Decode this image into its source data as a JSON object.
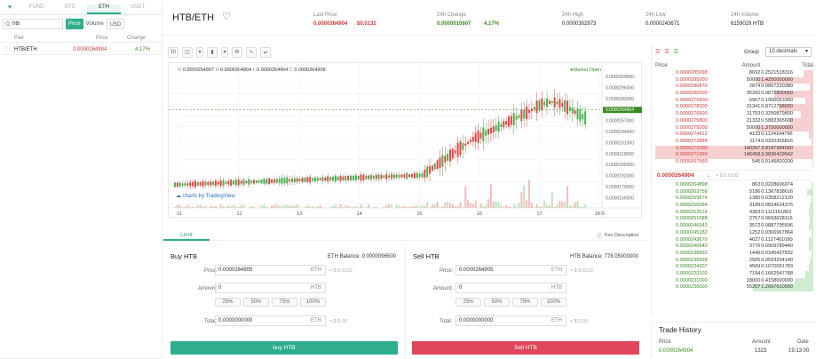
{
  "left": {
    "tabs": [
      "FUND",
      "BTC",
      "ETH",
      "USDT"
    ],
    "active_tab": "ETH",
    "search_value": "htb",
    "toggles": [
      "Price",
      "Volume",
      "USD"
    ],
    "headers": [
      "Pair",
      "Price",
      "Change"
    ],
    "rows": [
      {
        "pair": "HTB/ETH",
        "price": "0.0000264904",
        "change": "4.17%"
      }
    ]
  },
  "header": {
    "pair": "HTB/ETH",
    "last_price_label": "Last Price",
    "last_price": "0.0000264904",
    "last_price_usd": "$0.0132",
    "change_label": "24h Change",
    "change_value": "0.0000010607",
    "change_pct": "4.17%",
    "high_label": "24h High",
    "high_value": "0.0000302973",
    "low_label": "24h Low",
    "low_value": "0.0000243671",
    "volume_label": "24h Volume",
    "volume_value": "6159029 HTB"
  },
  "chart": {
    "interval": "1h",
    "ohlc": {
      "o": "0.0000264907",
      "h": "0.0000264904",
      "l": "0.0000264904",
      "c": "0.0000264908"
    },
    "market_status": "Market Open",
    "credit": "charts by TradingView",
    "price_labels": [
      "0.0000309000",
      "0.0000296000",
      "0.0000283000",
      "0.0000264904",
      "0.0000257000",
      "0.0000244000",
      "0.0000231000",
      "0.0000218000",
      "0.0000205000",
      "0.0000192000",
      "0.0000179000",
      "0.0000166000"
    ],
    "current_price": "0.0000264904",
    "x_labels": [
      "11",
      "12",
      "13",
      "14",
      "15",
      "16",
      "17",
      "18:0"
    ]
  },
  "trade": {
    "tab": "Limit",
    "fee_link": "Fee Description",
    "buy": {
      "title": "Buy HTB",
      "balance": "ETH Balance: 0.0000096500",
      "price_label": "Price:",
      "price": "0.0000264905",
      "price_unit": "ETH",
      "price_usd": "≈ $ 0.0132",
      "amount_label": "Amount:",
      "amount": "0",
      "amount_unit": "HTB",
      "pcts": [
        "25%",
        "50%",
        "75%",
        "100%"
      ],
      "total_label": "Total:",
      "total": "0.0000000000",
      "total_unit": "ETH",
      "total_usd": "≈ $ 0.00",
      "button": "buy HTB"
    },
    "sell": {
      "title": "Sell HTB",
      "balance": "HTB Balance: 778.05000000",
      "price_label": "Price:",
      "price": "0.0000264905",
      "price_unit": "ETH",
      "price_usd": "≈ $ 0.0132",
      "amount_label": "Amount:",
      "amount": "0",
      "amount_unit": "HTB",
      "pcts": [
        "25%",
        "50%",
        "75%",
        "100%"
      ],
      "total_label": "Total:",
      "total": "0.0000000000",
      "total_unit": "ETH",
      "total_usd": "≈ $ 0.00",
      "button": "Sell HTB"
    }
  },
  "orderbook": {
    "group_label": "Group",
    "decimals": "10 decimals",
    "headers": [
      "Price",
      "Amount",
      "Total"
    ],
    "asks": [
      {
        "price": "0.0000285998",
        "amount": "8692",
        "total": "0.2521518316"
      },
      {
        "price": "0.0000285000",
        "amount": "50000",
        "total": "1.4250000000"
      },
      {
        "price": "0.0000280870",
        "amount": "2874",
        "total": "0.0807220380"
      },
      {
        "price": "0.0000280000",
        "amount": "35260",
        "total": "0.9872800000"
      },
      {
        "price": "0.0000279900",
        "amount": "6967",
        "total": "0.1950063300"
      },
      {
        "price": "0.0000278000",
        "amount": "31341",
        "total": "0.8712798000"
      },
      {
        "price": "0.0000276600",
        "amount": "11753",
        "total": "0.3250879800"
      },
      {
        "price": "0.0000275800",
        "amount": "21332",
        "total": "0.5883365600"
      },
      {
        "price": "0.0000275000",
        "amount": "50000",
        "total": "1.3750000000"
      },
      {
        "price": "0.0000274412",
        "amount": "4133",
        "total": "0.1134144796"
      },
      {
        "price": "0.0000272884",
        "amount": "1174",
        "total": "0.0320365816"
      },
      {
        "price": "0.0000272000",
        "amount": "140397",
        "total": "3.8187984000"
      },
      {
        "price": "0.0000271999",
        "amount": "146458",
        "total": "3.9836429542"
      },
      {
        "price": "0.0000267560",
        "amount": "545",
        "total": "0.0145820200"
      }
    ],
    "ask_depth": [
      0.06,
      0.36,
      0.02,
      0.25,
      0.05,
      0.22,
      0.08,
      0.15,
      0.36,
      0.03,
      0.01,
      1.0,
      1.0,
      0.004
    ],
    "mid_price": "0.0000264904",
    "mid_arrow": "↓",
    "mid_usd": "≈ $ 0.0132",
    "bids": [
      {
        "price": "0.0000264898",
        "amount": "863",
        "total": "0.0228606974"
      },
      {
        "price": "0.0000263756",
        "amount": "5186",
        "total": "0.1367838616"
      },
      {
        "price": "0.0000259574",
        "amount": "1380",
        "total": "0.0358212120"
      },
      {
        "price": "0.0000256584",
        "amount": "3189",
        "total": "0.0824624376"
      },
      {
        "price": "0.0000253514",
        "amount": "4383",
        "total": "0.1111151862"
      },
      {
        "price": "0.0000251588",
        "amount": "2757",
        "total": "0.0693628116"
      },
      {
        "price": "0.0000246543",
        "amount": "3572",
        "total": "0.0887795596"
      },
      {
        "price": "0.0000245182",
        "amount": "1252",
        "total": "0.0306967864"
      },
      {
        "price": "0.0000243670",
        "amount": "4627",
        "total": "0.1127461090"
      },
      {
        "price": "0.0000240940",
        "amount": "3776",
        "total": "0.0909789440"
      },
      {
        "price": "0.0000238892",
        "amount": "1446",
        "total": "0.0345437832"
      },
      {
        "price": "0.0000236828",
        "amount": "2505",
        "total": "0.0593254140"
      },
      {
        "price": "0.0000234207",
        "amount": "4569",
        "total": "0.1070091783"
      },
      {
        "price": "0.0000231102",
        "amount": "7194",
        "total": "0.1662547788"
      },
      {
        "price": "0.0000231000",
        "amount": "18000",
        "total": "0.4158000000"
      },
      {
        "price": "0.0000230000",
        "amount": "55207",
        "total": "1.2697610000"
      }
    ],
    "bid_depth": [
      0.01,
      0.04,
      0.01,
      0.02,
      0.03,
      0.02,
      0.03,
      0.01,
      0.03,
      0.03,
      0.01,
      0.02,
      0.03,
      0.05,
      0.12,
      0.38
    ]
  },
  "trade_history": {
    "title": "Trade History",
    "headers": [
      "Price",
      "Amount",
      "Date"
    ],
    "rows": [
      {
        "price": "0.0000264904",
        "amount": "1323",
        "date": "19:13:00"
      }
    ]
  },
  "colors": {
    "green": "#3a8a24",
    "red": "#d33a3a",
    "buy": "#2eae8c",
    "sell": "#e0475c"
  }
}
